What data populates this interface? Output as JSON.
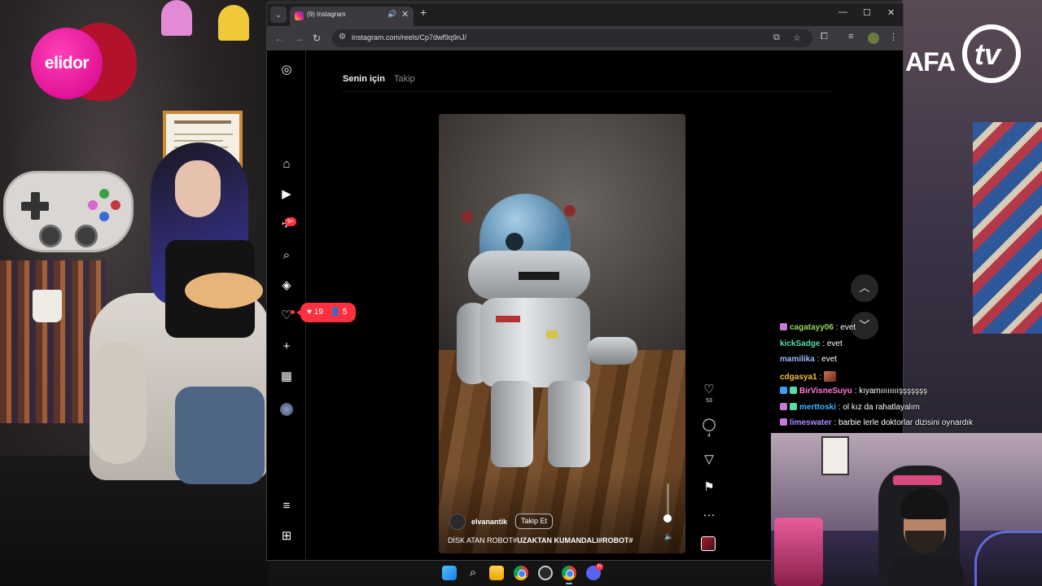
{
  "browser": {
    "tab_title": "(9) Instagram",
    "url": "instagram.com/reels/Cp7dwf9q9nJ/",
    "tab_close": "✕",
    "new_tab": "+",
    "window_controls": [
      "—",
      "☐",
      "✕"
    ]
  },
  "instagram": {
    "feed_tabs": {
      "active": "Senin için",
      "other": "Takip"
    },
    "rail": {
      "icons": [
        "instagram-logo",
        "home",
        "reels",
        "messages",
        "search",
        "explore",
        "notifications",
        "create",
        "dashboard",
        "profile",
        "menu",
        "threads"
      ],
      "messages_badge": "9+"
    },
    "activity": {
      "likes": "19",
      "follows": "5"
    },
    "reel": {
      "author": "elvanantik",
      "follow_label": "Takip Et",
      "caption_plain": "DİSK ATAN ROBOT#",
      "caption_bold": "UZAKTAN KUMANDALI#ROBOT#",
      "likes": "53",
      "comments": "4"
    }
  },
  "stream": {
    "sponsor": "elidor",
    "channel_logo": {
      "afa": "AFA",
      "tv": "tv"
    },
    "chat": [
      {
        "user": "cagatayy06",
        "message": "evet",
        "user_color": "#9ad65c",
        "badge": "#c47ad6"
      },
      {
        "user": "kickSadge",
        "message": "evet",
        "user_color": "#53e0a8"
      },
      {
        "user": "mamilika",
        "message": "evet",
        "user_color": "#9fb8ff"
      },
      {
        "user": "cdgasya1",
        "message": "",
        "user_color": "#f0c040",
        "emote": true
      },
      {
        "user": "BirVisneSuyu",
        "message": "kıyamıııııııışşşşşşş",
        "user_color": "#ff7ad9",
        "badge": "#3f9cff"
      },
      {
        "user": "merttoski",
        "message": "ol kız da rahatlayalım",
        "user_color": "#3fb7ff",
        "badge": "#c47ad6"
      },
      {
        "user": "limeswater",
        "message": "barbie lerle doktorlar dizisini oynardık",
        "user_color": "#a98cff",
        "badge": "#c47ad6"
      }
    ]
  },
  "taskbar": {
    "apps": [
      "windows-start",
      "search",
      "file-explorer",
      "chrome",
      "settings",
      "chrome-active",
      "discord"
    ],
    "discord_badge": "9+"
  }
}
